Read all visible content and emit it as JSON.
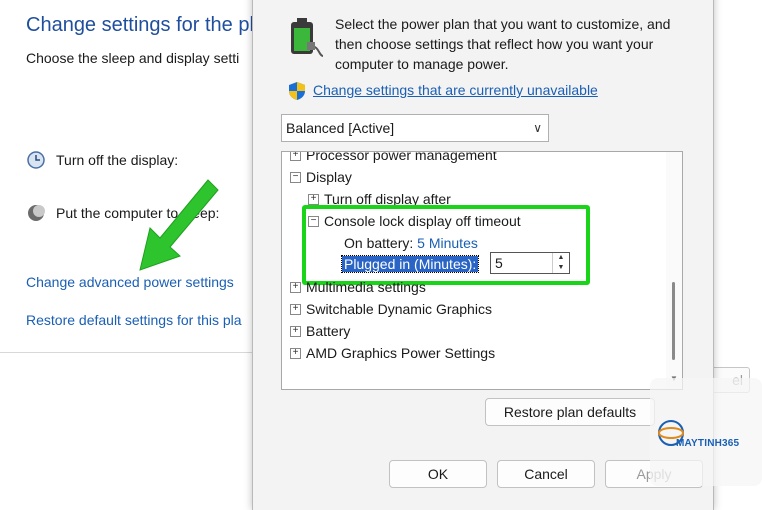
{
  "background_window": {
    "title": "Change settings for the pla",
    "subtitle": "Choose the sleep and display setti",
    "display_label": "Turn off the display:",
    "sleep_label": "Put the computer to sleep:",
    "advanced_link": "Change advanced power settings",
    "restore_link": "Restore default settings for this pla",
    "cancel_partial": "el"
  },
  "dialog": {
    "intro": "Select the power plan that you want to customize, and then choose settings that reflect how you want your computer to manage power.",
    "unavailable_link": "Change settings that are currently unavailable",
    "plan_select": "Balanced [Active]",
    "tree": {
      "processor": "Processor power management",
      "display": "Display",
      "turn_off_display": "Turn off display after",
      "console_lock": "Console lock display off timeout",
      "on_battery_label": "On battery:",
      "on_battery_value": "5 Minutes",
      "plugged_in_label": "Plugged in (Minutes):",
      "plugged_in_value": "5",
      "multimedia": "Multimedia settings",
      "switchable": "Switchable Dynamic Graphics",
      "battery": "Battery",
      "amd": "AMD Graphics Power Settings"
    },
    "restore_plan_button": "Restore plan defaults",
    "ok_button": "OK",
    "cancel_button": "Cancel",
    "apply_button": "Apply"
  },
  "watermark": {
    "brand": "MAYTINH365"
  },
  "colors": {
    "highlight": "#1ad41a",
    "link": "#1a5fb4",
    "selection": "#2a64c5",
    "arrow": "#2ec42e"
  }
}
